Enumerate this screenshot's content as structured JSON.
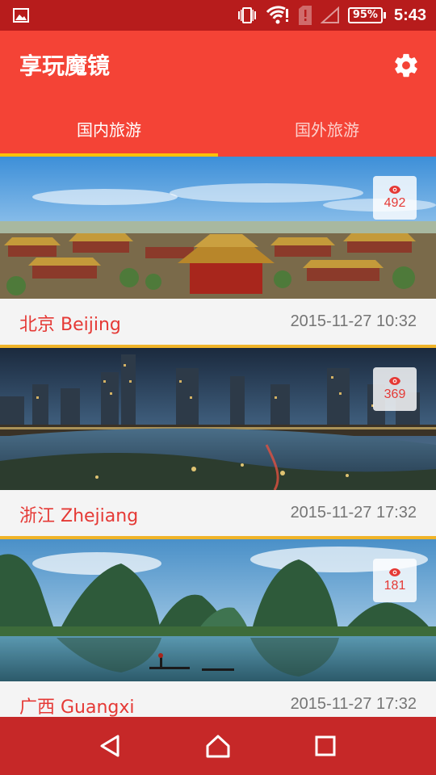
{
  "status_bar": {
    "battery": "95%",
    "time": "5:43",
    "icons": [
      "image-icon",
      "vibrate-icon",
      "wifi-alert-icon",
      "sim-alert-icon",
      "signal-icon",
      "battery-icon"
    ]
  },
  "app_bar": {
    "title": "享玩魔镜",
    "settings_icon": "gear-icon"
  },
  "tabs": [
    {
      "label": "国内旅游",
      "active": true
    },
    {
      "label": "国外旅游",
      "active": false
    }
  ],
  "colors": {
    "primary": "#f44336",
    "primary_dark": "#b71c1c",
    "accent": "#ffc107",
    "nav": "#c62828"
  },
  "destinations": [
    {
      "name": "北京 Beijing",
      "date": "2015-11-27 10:32",
      "views": "492",
      "scene": "forbidden-city"
    },
    {
      "name": "浙江 Zhejiang",
      "date": "2015-11-27 17:32",
      "views": "369",
      "scene": "night-city"
    },
    {
      "name": "广西 Guangxi",
      "date": "2015-11-27 17:32",
      "views": "181",
      "scene": "karst-river"
    }
  ],
  "nav_bar": [
    "back-icon",
    "home-icon",
    "recents-icon"
  ]
}
